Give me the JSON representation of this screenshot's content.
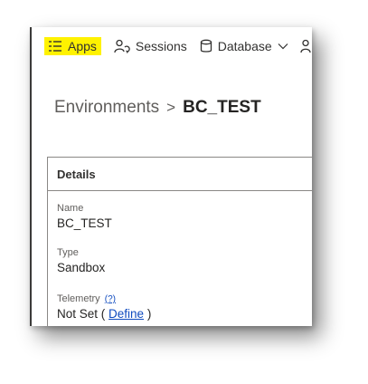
{
  "nav": {
    "items": [
      {
        "label": "Apps",
        "icon": "app-list-icon",
        "highlight": "#fff200"
      },
      {
        "label": "Sessions",
        "icon": "person-sync-icon"
      },
      {
        "label": "Database",
        "icon": "database-icon",
        "dropdown": true
      },
      {
        "label": "",
        "icon": "person-icon"
      }
    ]
  },
  "breadcrumb": {
    "parent": "Environments",
    "separator": ">",
    "current": "BC_TEST"
  },
  "details": {
    "title": "Details",
    "name": {
      "label": "Name",
      "value": "BC_TEST"
    },
    "type": {
      "label": "Type",
      "value": "Sandbox"
    },
    "telemetry": {
      "label": "Telemetry",
      "help_link": "(?)",
      "value_prefix": "Not Set (",
      "define_link": "Define",
      "value_suffix": ")"
    }
  },
  "colors": {
    "link": "#0f4bbf",
    "highlight": "#fff200",
    "text": "#252423"
  }
}
